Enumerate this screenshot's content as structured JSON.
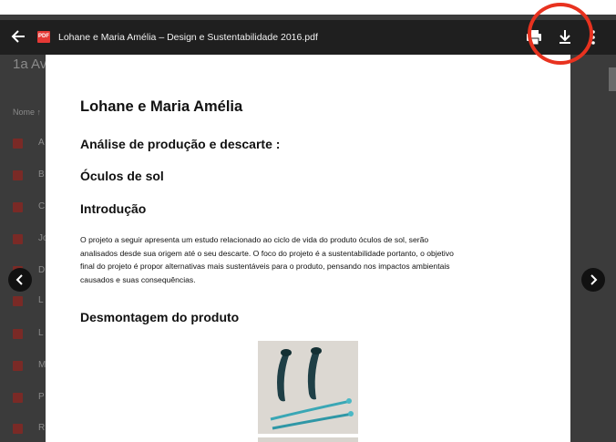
{
  "viewer": {
    "title": "Lohane e Maria Amélia – Design e Sustentabilidade 2016.pdf",
    "file_badge": "PDF",
    "icons": [
      "arrow-left-icon",
      "print-icon",
      "download-icon",
      "more-vert-icon",
      "chevron-left-icon",
      "chevron-right-icon"
    ],
    "highlight_color": "#e8321f"
  },
  "background": {
    "folder_title": "1a Av",
    "column_header": "Nome ↑",
    "items": [
      "A",
      "B",
      "C",
      "Jo",
      "D",
      "L",
      "L",
      "M",
      "P",
      "R"
    ]
  },
  "document": {
    "heading": "Lohane e Maria Amélia",
    "subheading": "Análise de produção e descarte :",
    "product": "Óculos de sol",
    "intro_title": "Introdução",
    "intro_lines": [
      "O projeto a seguir apresenta um estudo relacionado ao ciclo de vida do produto óculos de sol, serão",
      "analisados desde sua origem até o seu descarte. O foco do projeto é a sustentabilidade portanto, o objetivo",
      "final do projeto é propor alternativas mais sustentáveis para o produto, pensando nos impactos ambientais",
      "causados e suas consequências."
    ],
    "section_title": "Desmontagem do produto"
  }
}
